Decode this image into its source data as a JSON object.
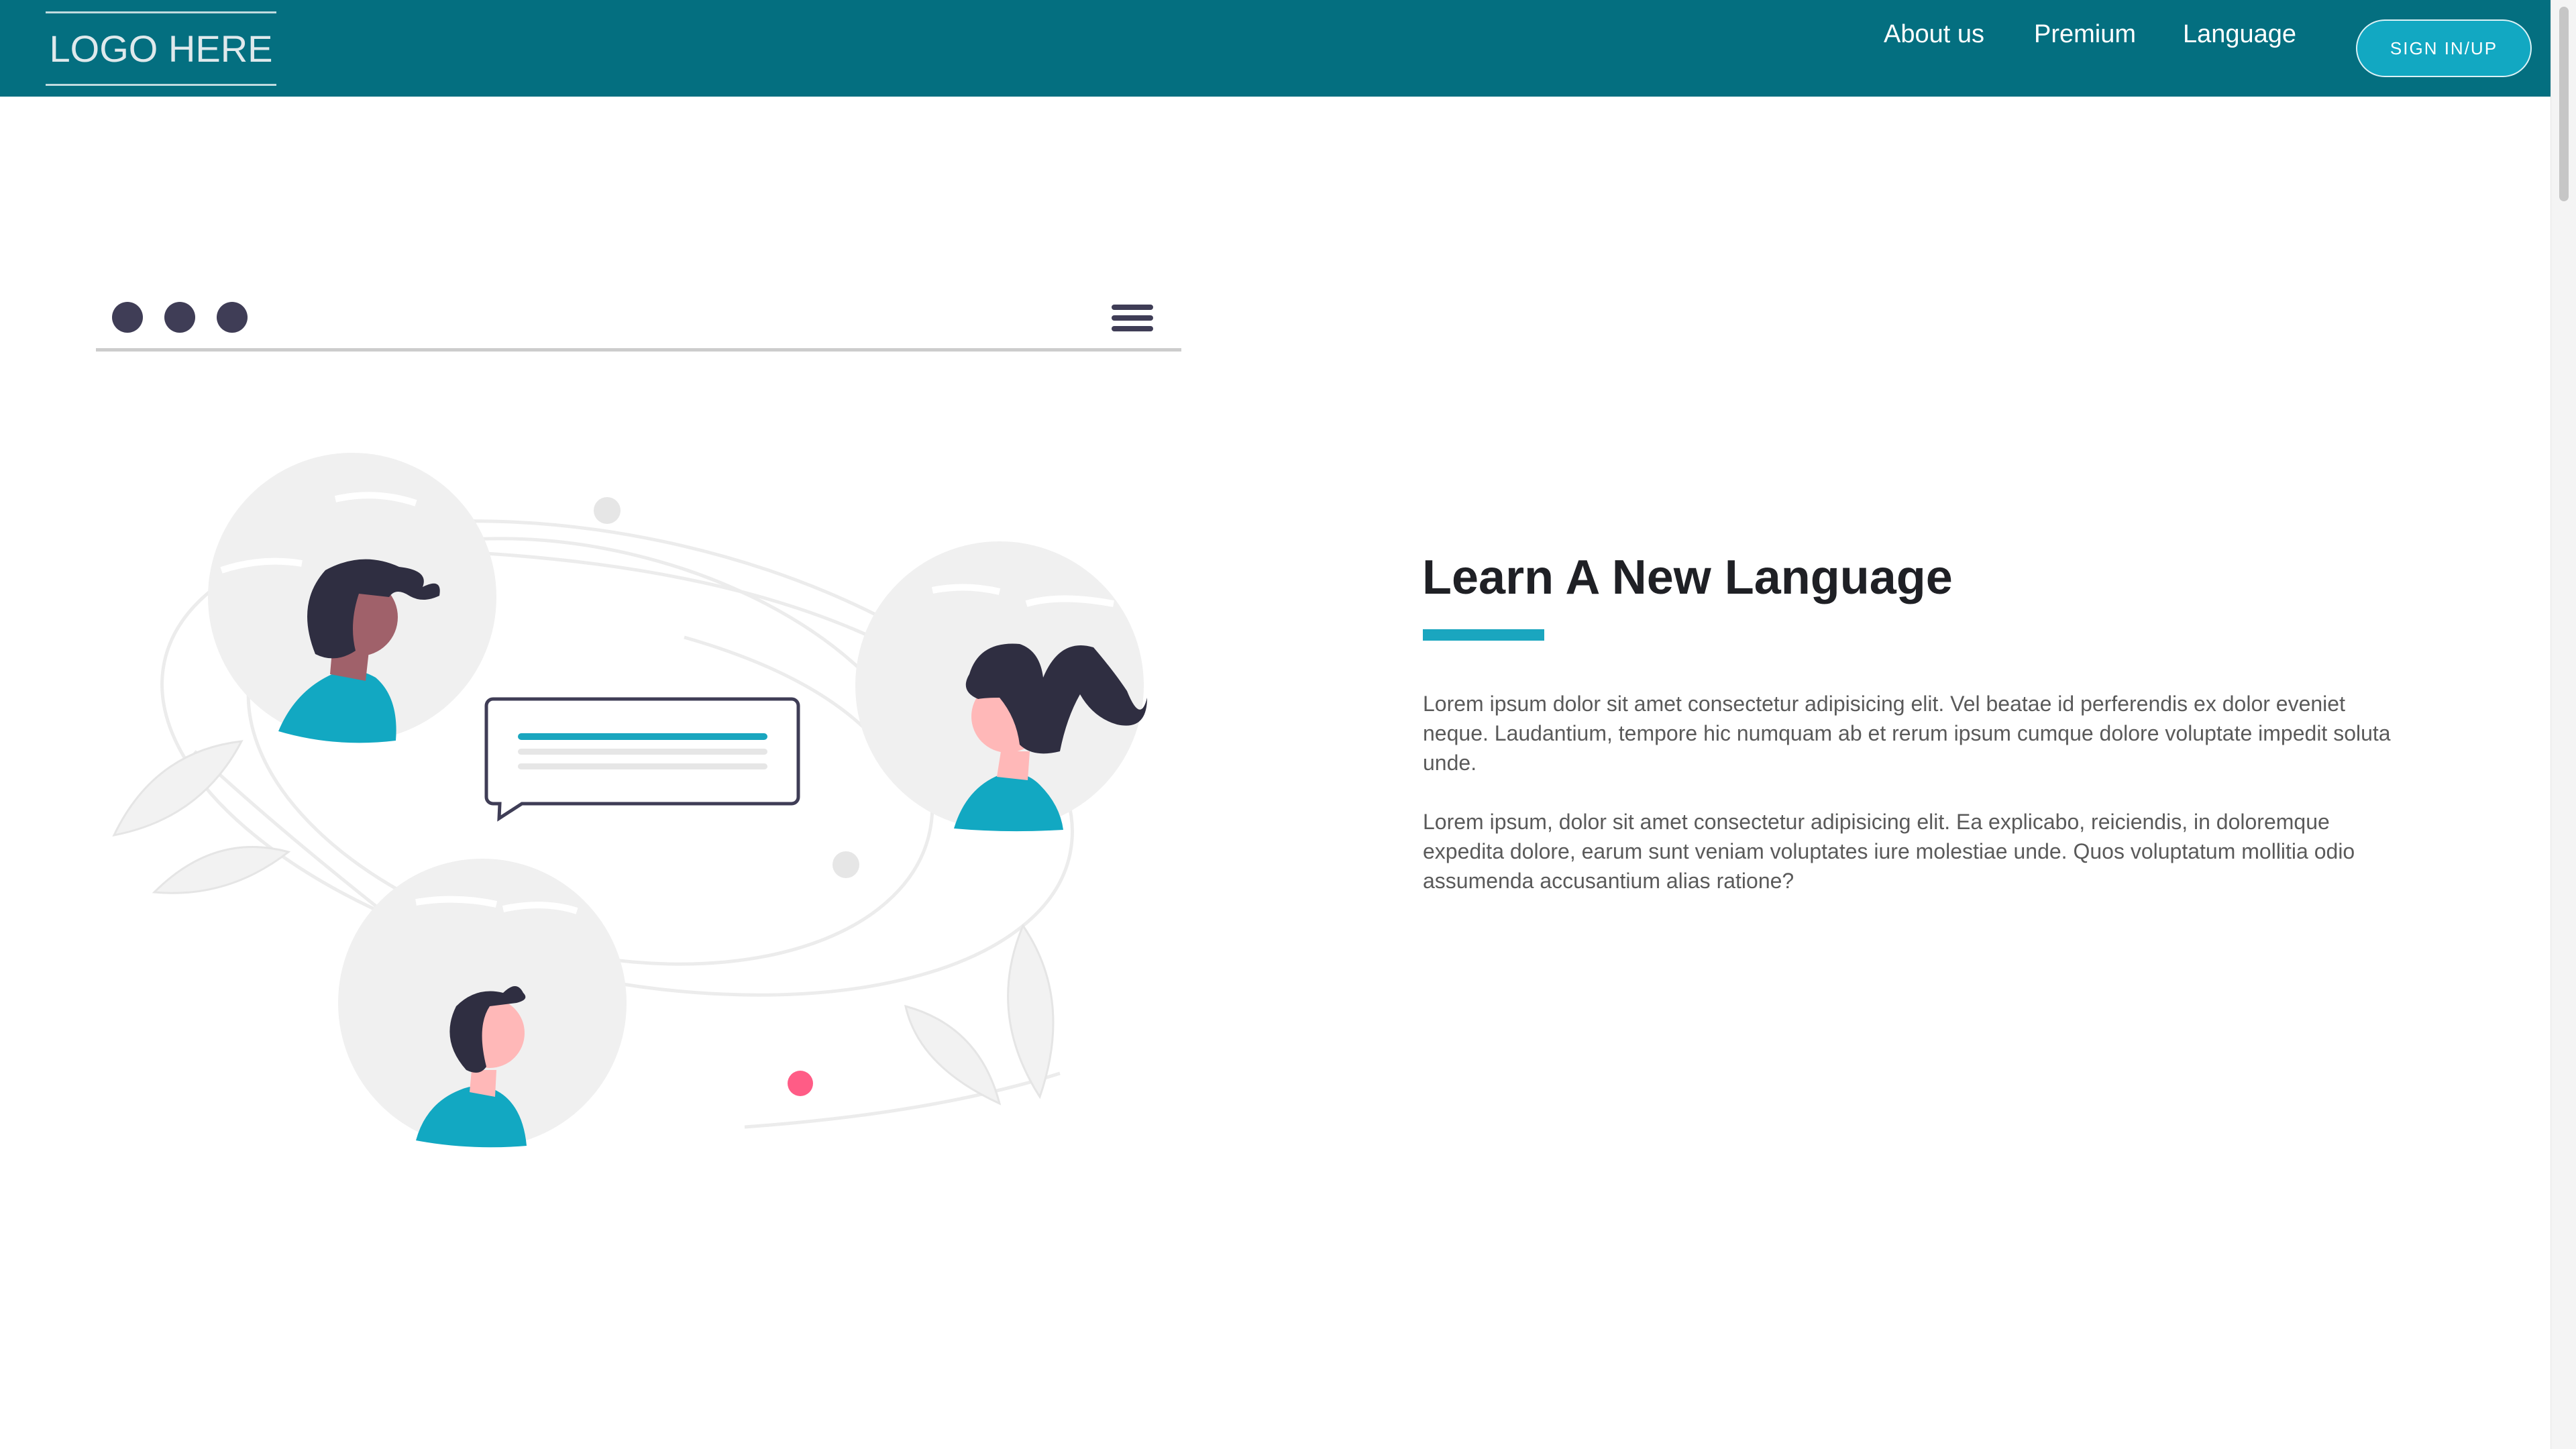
{
  "header": {
    "logo_text": "LOGO HERE",
    "nav": [
      "About us",
      "Premium",
      "Language"
    ],
    "signin_label": "SIGN IN/UP"
  },
  "colors": {
    "header_bg": "#046f80",
    "accent": "#1aa6bf",
    "button_bg": "#12a8c2",
    "avatar_bg": "#f0f0f0",
    "dark": "#2f2e41",
    "highlight_dot": "#ff5c86"
  },
  "icons": [
    "menu-icon",
    "window-dot-icon"
  ],
  "main": {
    "heading": "Learn A New Language",
    "paragraphs": [
      "Lorem ipsum dolor sit amet consectetur adipisicing elit. Vel beatae id perferendis ex dolor eveniet neque. Laudantium, tempore hic numquam ab et rerum ipsum cumque dolore voluptate impedit soluta unde.",
      "Lorem ipsum, dolor sit amet consectetur adipisicing elit. Ea explicabo, reiciendis, in doloremque expedita dolore, earum sunt veniam voluptates iure molestiae unde. Quos voluptatum mollitia odio assumenda accusantium alias ratione?"
    ]
  }
}
